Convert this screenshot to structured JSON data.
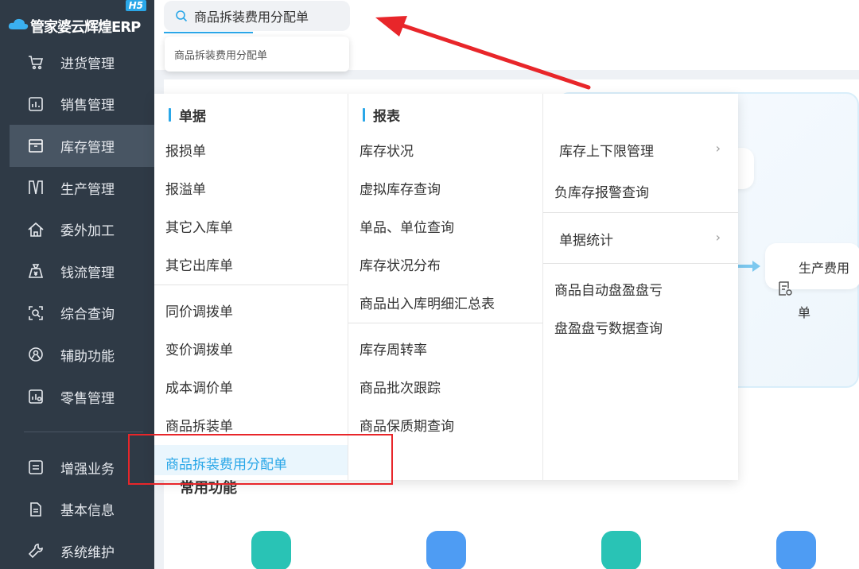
{
  "brand": {
    "logo_text": "管家婆云辉煌ERP",
    "badge": "H5"
  },
  "sidebar": {
    "items": [
      {
        "label": "进货管理",
        "icon": "cart-icon"
      },
      {
        "label": "销售管理",
        "icon": "sales-chart-icon"
      },
      {
        "label": "库存管理",
        "icon": "box-icon",
        "active": true
      },
      {
        "label": "生产管理",
        "icon": "production-icon"
      },
      {
        "label": "委外加工",
        "icon": "home-icon"
      },
      {
        "label": "钱流管理",
        "icon": "money-bag-icon"
      },
      {
        "label": "综合查询",
        "icon": "scan-search-icon"
      },
      {
        "label": "辅助功能",
        "icon": "assist-icon"
      },
      {
        "label": "零售管理",
        "icon": "retail-icon"
      }
    ],
    "secondary": [
      {
        "label": "增强业务",
        "icon": "enhance-icon"
      },
      {
        "label": "基本信息",
        "icon": "document-icon"
      },
      {
        "label": "系统维护",
        "icon": "maintenance-icon"
      }
    ]
  },
  "search": {
    "value": "商品拆装费用分配单",
    "suggestion": "商品拆装费用分配单"
  },
  "menu": {
    "col1": {
      "title": "单据",
      "group1": [
        "报损单",
        "报溢单",
        "其它入库单",
        "其它出库单"
      ],
      "group2": [
        "同价调拨单",
        "变价调拨单",
        "成本调价单",
        "商品拆装单",
        "商品拆装费用分配单"
      ]
    },
    "col2": {
      "title": "报表",
      "group1": [
        "库存状况",
        "虚拟库存查询",
        "单品、单位查询",
        "库存状况分布",
        "商品出入库明细汇总表"
      ],
      "group2": [
        "库存周转率",
        "商品批次跟踪",
        "商品保质期查询"
      ]
    },
    "col3": {
      "group1": [
        "库存上下限管理",
        "负库存报警查询"
      ],
      "group2": [
        "单据统计"
      ],
      "group3": [
        "商品自动盘盈盘亏",
        "盘盈盘亏数据查询"
      ]
    }
  },
  "dashboard": {
    "flow_node_line1": "生产费用",
    "flow_node_line2": "单",
    "common_title": "常用功能"
  },
  "colors": {
    "accent": "#2aa7e8",
    "sidebar": "#2f3a46",
    "annotation": "#e8262a"
  }
}
